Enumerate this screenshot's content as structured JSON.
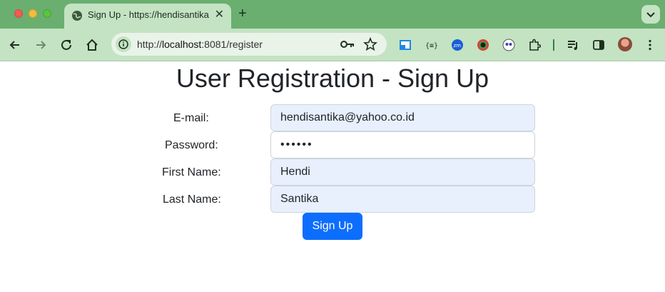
{
  "browser": {
    "tab_title": "Sign Up - https://hendisantika",
    "url_prefix": "http://",
    "url_host": "localhost",
    "url_rest": ":8081/register",
    "new_tab_symbol": "+",
    "tab_close_symbol": "✕"
  },
  "page": {
    "heading": "User Registration - Sign Up",
    "form": {
      "email_label": "E-mail:",
      "email_value": "hendisantika@yahoo.co.id",
      "password_label": "Password:",
      "password_value": "••••••",
      "first_name_label": "First Name:",
      "first_name_value": "Hendi",
      "last_name_label": "Last Name:",
      "last_name_value": "Santika",
      "submit_label": "Sign Up"
    }
  },
  "colors": {
    "chrome_frame": "#6aaf6f",
    "toolbar": "#c4e3c3",
    "button_primary": "#0d6efd",
    "autofill_bg": "#e8f0fe"
  },
  "icons": [
    "back-icon",
    "forward-icon",
    "reload-icon",
    "home-icon",
    "site-info-icon",
    "key-icon",
    "bookmark-star-icon",
    "extension-icon",
    "profile-avatar-icon",
    "menu-icon"
  ]
}
